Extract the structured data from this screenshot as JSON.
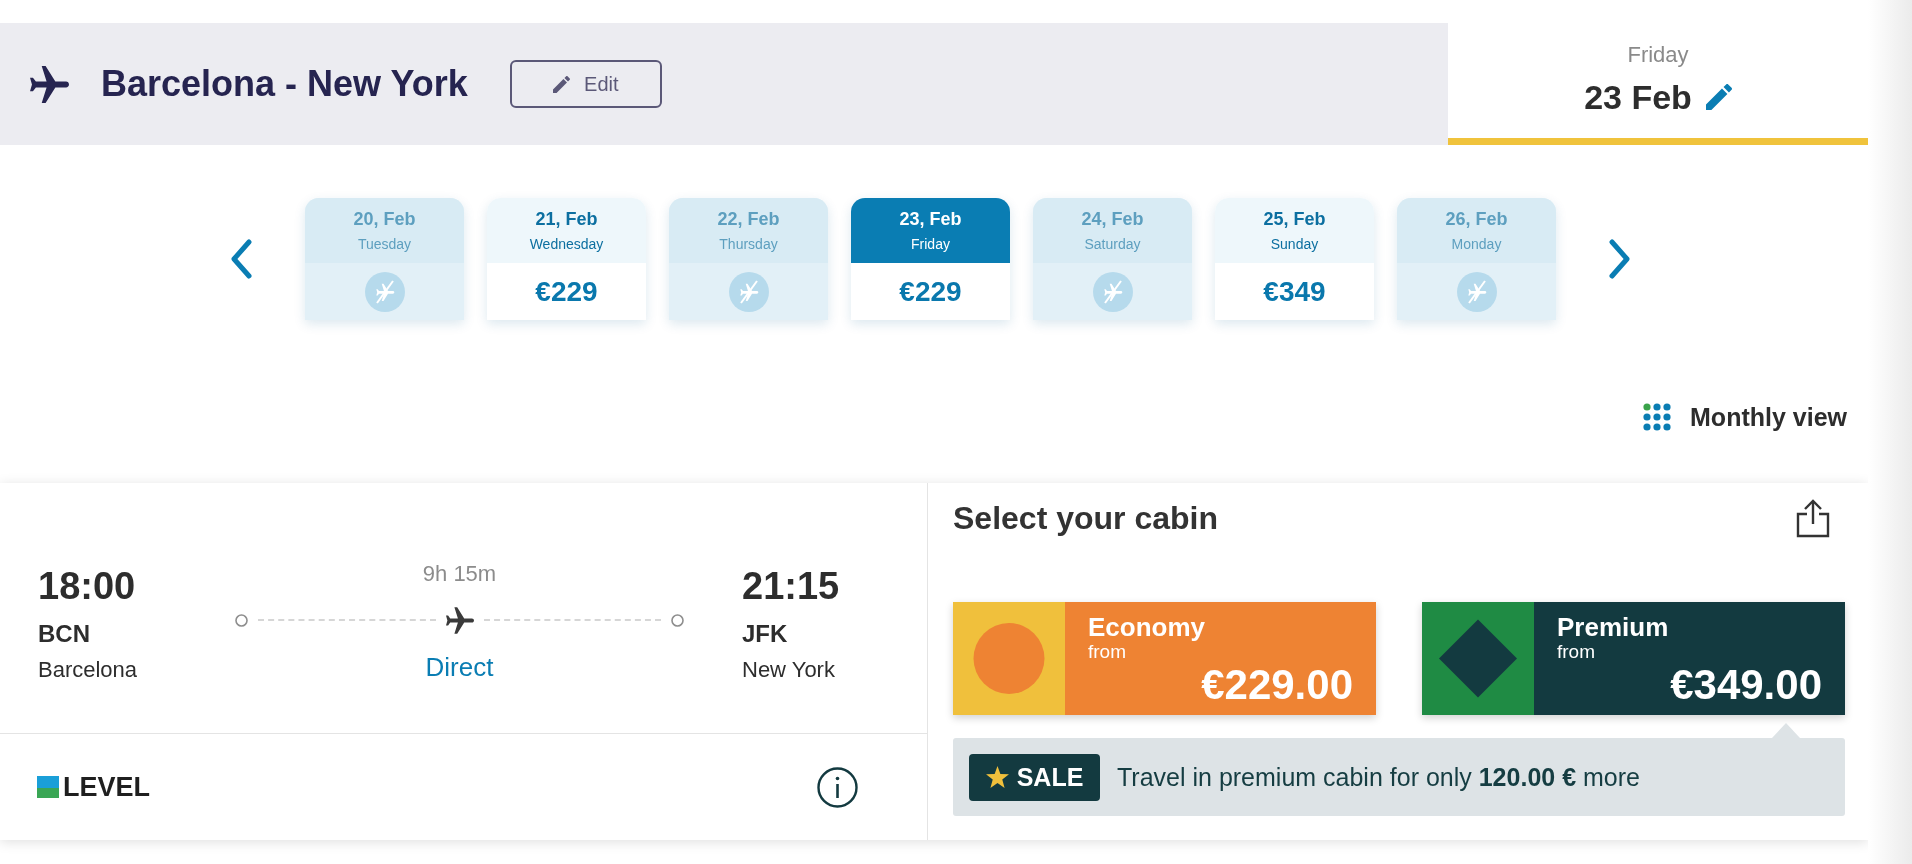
{
  "header": {
    "title": "Barcelona - New York",
    "edit_button": "Edit",
    "date_tab": {
      "weekday": "Friday",
      "date": "23 Feb"
    }
  },
  "date_strip": {
    "days": [
      {
        "date": "20, Feb",
        "weekday": "Tuesday",
        "disabled": true,
        "selected": false
      },
      {
        "date": "21, Feb",
        "weekday": "Wednesday",
        "disabled": false,
        "selected": false,
        "price": "€229"
      },
      {
        "date": "22, Feb",
        "weekday": "Thursday",
        "disabled": true,
        "selected": false
      },
      {
        "date": "23, Feb",
        "weekday": "Friday",
        "disabled": false,
        "selected": true,
        "price": "€229"
      },
      {
        "date": "24, Feb",
        "weekday": "Saturday",
        "disabled": true,
        "selected": false
      },
      {
        "date": "25, Feb",
        "weekday": "Sunday",
        "disabled": false,
        "selected": false,
        "price": "€349"
      },
      {
        "date": "26, Feb",
        "weekday": "Monday",
        "disabled": true,
        "selected": false
      }
    ]
  },
  "monthly_view_button": "Monthly view",
  "flight": {
    "departure": {
      "time": "18:00",
      "code": "BCN",
      "city": "Barcelona"
    },
    "duration": "9h 15m",
    "stops": "Direct",
    "arrival": {
      "time": "21:15",
      "code": "JFK",
      "city": "New York"
    },
    "airline": "LEVEL"
  },
  "cabin_panel": {
    "title": "Select your cabin",
    "cabins": [
      {
        "kind": "economy",
        "name": "Economy",
        "from_label": "from",
        "price": "€229.00"
      },
      {
        "kind": "premium",
        "name": "Premium",
        "from_label": "from",
        "price": "€349.00"
      }
    ],
    "sale": {
      "badge": "SALE",
      "text": "Travel in premium cabin for only **120.00 €** more"
    }
  }
}
